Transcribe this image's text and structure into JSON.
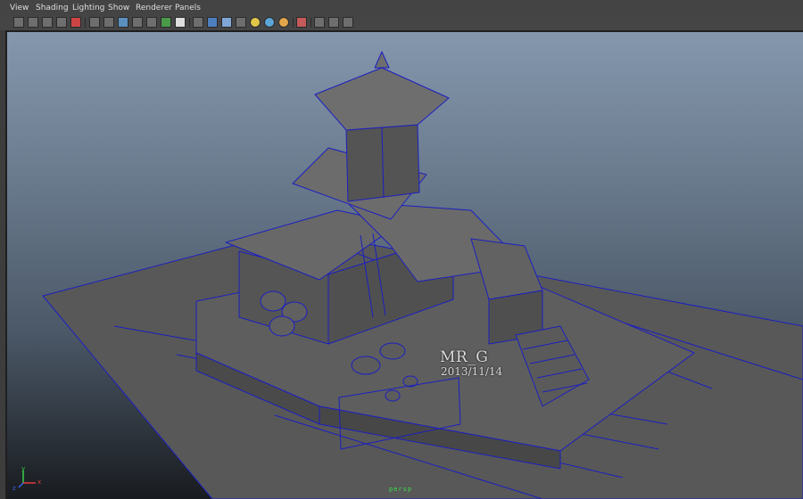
{
  "menus": [
    "View",
    "Shading",
    "Lighting",
    "Show",
    "Renderer",
    "Panels"
  ],
  "toolbar": {
    "icons": [
      "camera-select-icon",
      "camera-attributes-icon",
      "bookmarks-icon",
      "image-plane-icon",
      "2d-pan-zoom-icon",
      "grid-icon",
      "film-gate-icon",
      "resolution-gate-icon",
      "gate-mask-icon",
      "field-chart-icon",
      "safe-action-icon",
      "wireframe-icon",
      "smooth-shade-icon",
      "wireframe-on-shaded-icon",
      "textured-icon",
      "use-all-lights-icon",
      "shadows-icon",
      "ambient-occlusion-icon",
      "isolate-select-icon",
      "xray-icon",
      "xray-joints-icon",
      "share-icon"
    ]
  },
  "watermark": {
    "name": "MR_G",
    "date": "2013/11/14"
  },
  "axis": {
    "x_label": "x",
    "y_label": "y",
    "z_label": "z"
  },
  "viewport": {
    "camera": "persp",
    "colors": {
      "wire": "#1c1fbf",
      "surface": "#5a5a5a",
      "axis_x": "#e23b3b",
      "axis_y": "#37d04a",
      "axis_z": "#3b62e2"
    }
  }
}
